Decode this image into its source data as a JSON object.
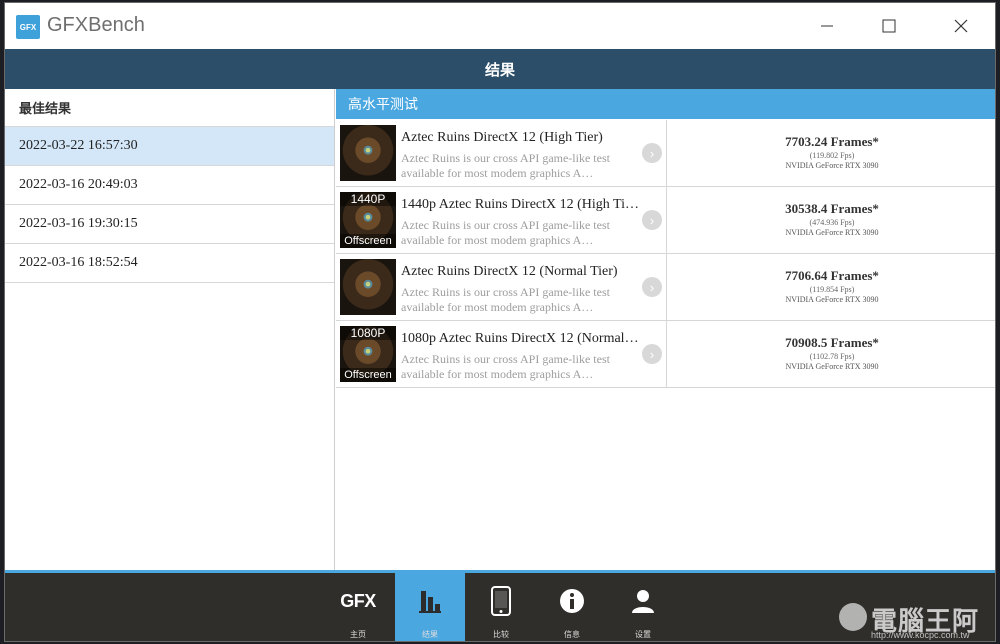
{
  "window": {
    "logo_text": "GFX",
    "title": "GFXBench"
  },
  "header": {
    "title": "结果"
  },
  "sidebar": {
    "heading": "最佳结果",
    "sessions": [
      {
        "label": "2022-03-22 16:57:30",
        "selected": true
      },
      {
        "label": "2022-03-16 20:49:03",
        "selected": false
      },
      {
        "label": "2022-03-16 19:30:15",
        "selected": false
      },
      {
        "label": "2022-03-16 18:52:54",
        "selected": false
      }
    ]
  },
  "main": {
    "category": "高水平测试",
    "results": [
      {
        "thumb_top": "",
        "thumb_bottom": "",
        "name": "Aztec Ruins DirectX 12 (High Tier)",
        "desc": "Aztec Ruins is our cross API game-like test available for most modem graphics A…",
        "score": "7703.24 Frames*",
        "fps": "(119.802 Fps)",
        "gpu": "NVIDIA GeForce RTX 3090"
      },
      {
        "thumb_top": "1440P",
        "thumb_bottom": "Offscreen",
        "name": "1440p Aztec Ruins DirectX 12 (High Ti…",
        "desc": "Aztec Ruins is our cross API game-like test available for most modem graphics A…",
        "score": "30538.4 Frames*",
        "fps": "(474.936 Fps)",
        "gpu": "NVIDIA GeForce RTX 3090"
      },
      {
        "thumb_top": "",
        "thumb_bottom": "",
        "name": "Aztec Ruins DirectX 12 (Normal Tier)",
        "desc": "Aztec Ruins is our cross API game-like test available for most modem graphics A…",
        "score": "7706.64 Frames*",
        "fps": "(119.854 Fps)",
        "gpu": "NVIDIA GeForce RTX 3090"
      },
      {
        "thumb_top": "1080P",
        "thumb_bottom": "Offscreen",
        "name": "1080p Aztec Ruins DirectX 12 (Normal…",
        "desc": "Aztec Ruins is our cross API game-like test available for most modem graphics A…",
        "score": "70908.5 Frames*",
        "fps": "(1102.78 Fps)",
        "gpu": "NVIDIA GeForce RTX 3090"
      }
    ]
  },
  "bottom_nav": {
    "home_icon_text": "GFX",
    "items": [
      {
        "label": "主页",
        "icon": "gfx-logo-icon",
        "active": false
      },
      {
        "label": "结果",
        "icon": "bar-chart-icon",
        "active": true
      },
      {
        "label": "比较",
        "icon": "phone-icon",
        "active": false
      },
      {
        "label": "信息",
        "icon": "info-icon",
        "active": false
      },
      {
        "label": "设置",
        "icon": "user-icon",
        "active": false
      }
    ]
  },
  "watermark": {
    "text": "電腦王阿達",
    "url": "http://www.kocpc.com.tw"
  },
  "colors": {
    "header": "#2c4e69",
    "accent": "#4aa7e0",
    "selected_row": "#d3e7f8",
    "nav_background": "#302e2b"
  }
}
